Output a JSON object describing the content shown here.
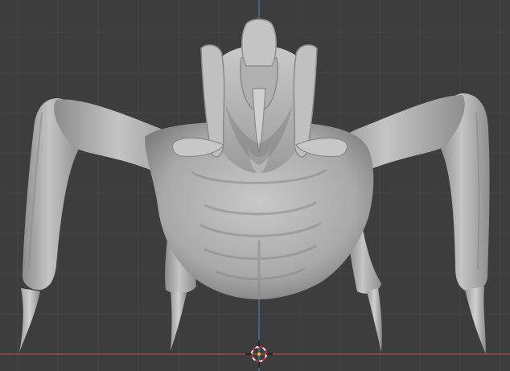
{
  "viewport": {
    "view": "front-orthographic",
    "shading": "solid",
    "background_color": "#3d3d3d",
    "grid_color": "#474747",
    "x_axis_color": "#b04848",
    "z_axis_color": "#4a7ab8",
    "mesh_color": "#b8b8b8",
    "show_grid": true,
    "show_axes": true
  },
  "scene_object": {
    "kind": "sculpted-creature-mesh",
    "icon": "alien-creature-sculpt"
  },
  "cursor_3d": {
    "icon": "3d-cursor-icon",
    "ring_colors": [
      "#e8e8e8",
      "#d03030"
    ]
  }
}
